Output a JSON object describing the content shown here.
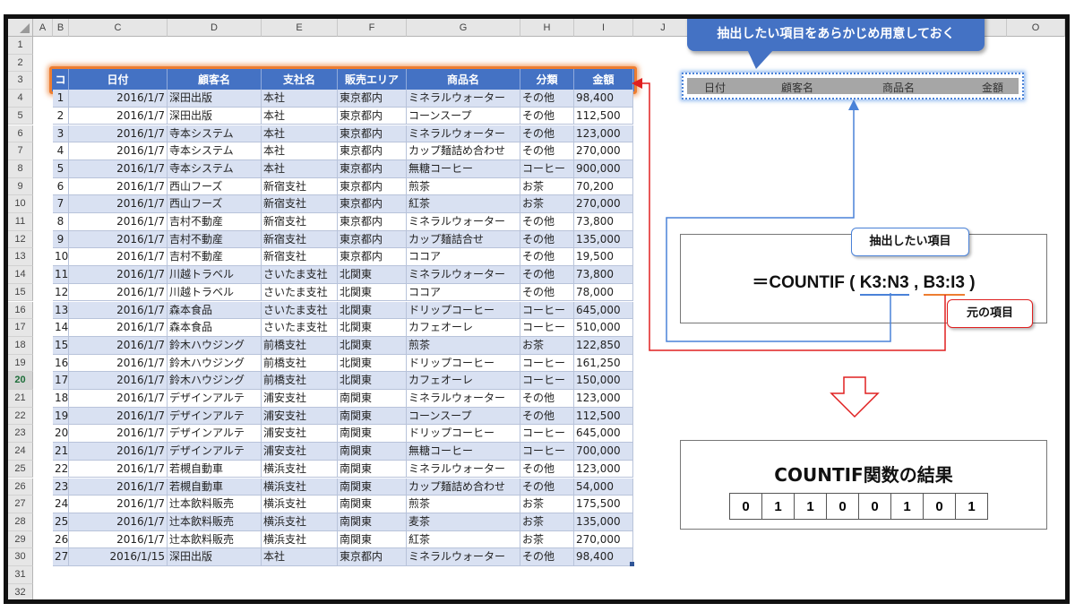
{
  "columns": [
    "A",
    "B",
    "C",
    "D",
    "E",
    "F",
    "G",
    "H",
    "I",
    "J",
    "K",
    "L",
    "M",
    "N",
    "O"
  ],
  "rows": [
    "1",
    "2",
    "3",
    "4",
    "5",
    "6",
    "7",
    "8",
    "9",
    "10",
    "11",
    "12",
    "13",
    "14",
    "15",
    "16",
    "17",
    "18",
    "19",
    "20",
    "21",
    "22",
    "23",
    "24",
    "25",
    "26",
    "27",
    "28",
    "29",
    "30",
    "31",
    "32"
  ],
  "selected_row": "20",
  "table": {
    "headers": [
      "コード",
      "日付",
      "顧客名",
      "支社名",
      "販売エリア",
      "商品名",
      "分類",
      "金額"
    ],
    "records": [
      [
        "1",
        "2016/1/7",
        "深田出版",
        "本社",
        "東京都内",
        "ミネラルウォーター",
        "その他",
        "98,400"
      ],
      [
        "2",
        "2016/1/7",
        "深田出版",
        "本社",
        "東京都内",
        "コーンスープ",
        "その他",
        "112,500"
      ],
      [
        "3",
        "2016/1/7",
        "寺本システム",
        "本社",
        "東京都内",
        "ミネラルウォーター",
        "その他",
        "123,000"
      ],
      [
        "4",
        "2016/1/7",
        "寺本システム",
        "本社",
        "東京都内",
        "カップ麺詰め合わせ",
        "その他",
        "270,000"
      ],
      [
        "5",
        "2016/1/7",
        "寺本システム",
        "本社",
        "東京都内",
        "無糖コーヒー",
        "コーヒー",
        "900,000"
      ],
      [
        "6",
        "2016/1/7",
        "西山フーズ",
        "新宿支社",
        "東京都内",
        "煎茶",
        "お茶",
        "70,200"
      ],
      [
        "7",
        "2016/1/7",
        "西山フーズ",
        "新宿支社",
        "東京都内",
        "紅茶",
        "お茶",
        "270,000"
      ],
      [
        "8",
        "2016/1/7",
        "吉村不動産",
        "新宿支社",
        "東京都内",
        "ミネラルウォーター",
        "その他",
        "73,800"
      ],
      [
        "9",
        "2016/1/7",
        "吉村不動産",
        "新宿支社",
        "東京都内",
        "カップ麺詰合せ",
        "その他",
        "135,000"
      ],
      [
        "10",
        "2016/1/7",
        "吉村不動産",
        "新宿支社",
        "東京都内",
        "ココア",
        "その他",
        "19,500"
      ],
      [
        "11",
        "2016/1/7",
        "川越トラベル",
        "さいたま支社",
        "北関東",
        "ミネラルウォーター",
        "その他",
        "73,800"
      ],
      [
        "12",
        "2016/1/7",
        "川越トラベル",
        "さいたま支社",
        "北関東",
        "ココア",
        "その他",
        "78,000"
      ],
      [
        "13",
        "2016/1/7",
        "森本食品",
        "さいたま支社",
        "北関東",
        "ドリップコーヒー",
        "コーヒー",
        "645,000"
      ],
      [
        "14",
        "2016/1/7",
        "森本食品",
        "さいたま支社",
        "北関東",
        "カフェオーレ",
        "コーヒー",
        "510,000"
      ],
      [
        "15",
        "2016/1/7",
        "鈴木ハウジング",
        "前橋支社",
        "北関東",
        "煎茶",
        "お茶",
        "122,850"
      ],
      [
        "16",
        "2016/1/7",
        "鈴木ハウジング",
        "前橋支社",
        "北関東",
        "ドリップコーヒー",
        "コーヒー",
        "161,250"
      ],
      [
        "17",
        "2016/1/7",
        "鈴木ハウジング",
        "前橋支社",
        "北関東",
        "カフェオーレ",
        "コーヒー",
        "150,000"
      ],
      [
        "18",
        "2016/1/7",
        "デザインアルテ",
        "浦安支社",
        "南関東",
        "ミネラルウォーター",
        "その他",
        "123,000"
      ],
      [
        "19",
        "2016/1/7",
        "デザインアルテ",
        "浦安支社",
        "南関東",
        "コーンスープ",
        "その他",
        "112,500"
      ],
      [
        "20",
        "2016/1/7",
        "デザインアルテ",
        "浦安支社",
        "南関東",
        "ドリップコーヒー",
        "コーヒー",
        "645,000"
      ],
      [
        "21",
        "2016/1/7",
        "デザインアルテ",
        "浦安支社",
        "南関東",
        "無糖コーヒー",
        "コーヒー",
        "700,000"
      ],
      [
        "22",
        "2016/1/7",
        "若槻自動車",
        "横浜支社",
        "南関東",
        "ミネラルウォーター",
        "その他",
        "123,000"
      ],
      [
        "23",
        "2016/1/7",
        "若槻自動車",
        "横浜支社",
        "南関東",
        "カップ麺詰め合わせ",
        "その他",
        "54,000"
      ],
      [
        "24",
        "2016/1/7",
        "辻本飲料販売",
        "横浜支社",
        "南関東",
        "煎茶",
        "お茶",
        "175,500"
      ],
      [
        "25",
        "2016/1/7",
        "辻本飲料販売",
        "横浜支社",
        "南関東",
        "麦茶",
        "お茶",
        "135,000"
      ],
      [
        "26",
        "2016/1/7",
        "辻本飲料販売",
        "横浜支社",
        "南関東",
        "紅茶",
        "お茶",
        "270,000"
      ],
      [
        "27",
        "2016/1/15",
        "深田出版",
        "本社",
        "東京都内",
        "ミネラルウォーター",
        "その他",
        "98,400"
      ]
    ]
  },
  "extract_headers": [
    "日付",
    "顧客名",
    "商品名",
    "金額"
  ],
  "callout_top": "抽出したい項目をあらかじめ用意しておく",
  "formula": {
    "prefix": "＝COUNTIF (",
    "range1": "K3:N3",
    "comma": ",",
    "range2": "B3:I3",
    "suffix": ")",
    "note_range1": "抽出したい項目",
    "note_range2": "元の項目"
  },
  "result": {
    "title": "COUNTIF関数の結果",
    "values": [
      "0",
      "1",
      "1",
      "0",
      "0",
      "1",
      "0",
      "1"
    ]
  },
  "colors": {
    "header_blue": "#4472c4",
    "band_blue": "#d9e1f2",
    "highlight_orange": "#ed7d31",
    "arrow_red": "#e02020",
    "row_selected_green": "#1e6e3a"
  }
}
